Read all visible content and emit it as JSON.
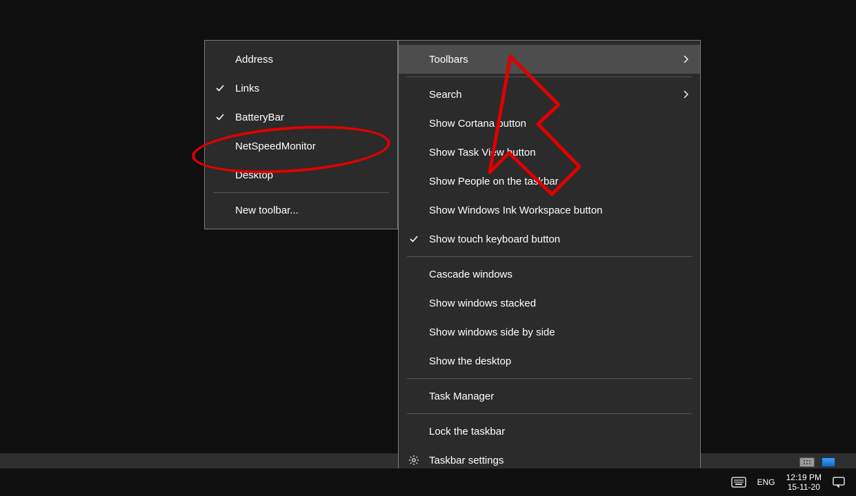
{
  "submenu": {
    "items": [
      {
        "label": "Address",
        "checked": false
      },
      {
        "label": "Links",
        "checked": true
      },
      {
        "label": "BatteryBar",
        "checked": true
      },
      {
        "label": "NetSpeedMonitor",
        "checked": false
      },
      {
        "label": "Desktop",
        "checked": false
      }
    ],
    "new_toolbar": "New toolbar..."
  },
  "mainmenu": {
    "toolbars": "Toolbars",
    "search": "Search",
    "cortana": "Show Cortana button",
    "taskview": "Show Task View button",
    "people": "Show People on the taskbar",
    "ink": "Show Windows Ink Workspace button",
    "touch": "Show touch keyboard button",
    "cascade": "Cascade windows",
    "stacked": "Show windows stacked",
    "sidebyside": "Show windows side by side",
    "showdesktop": "Show the desktop",
    "taskmanager": "Task Manager",
    "lock": "Lock the taskbar",
    "settings": "Taskbar settings"
  },
  "taskbar": {
    "lang": "ENG",
    "time": "12:19 PM",
    "date": "15-11-20"
  }
}
